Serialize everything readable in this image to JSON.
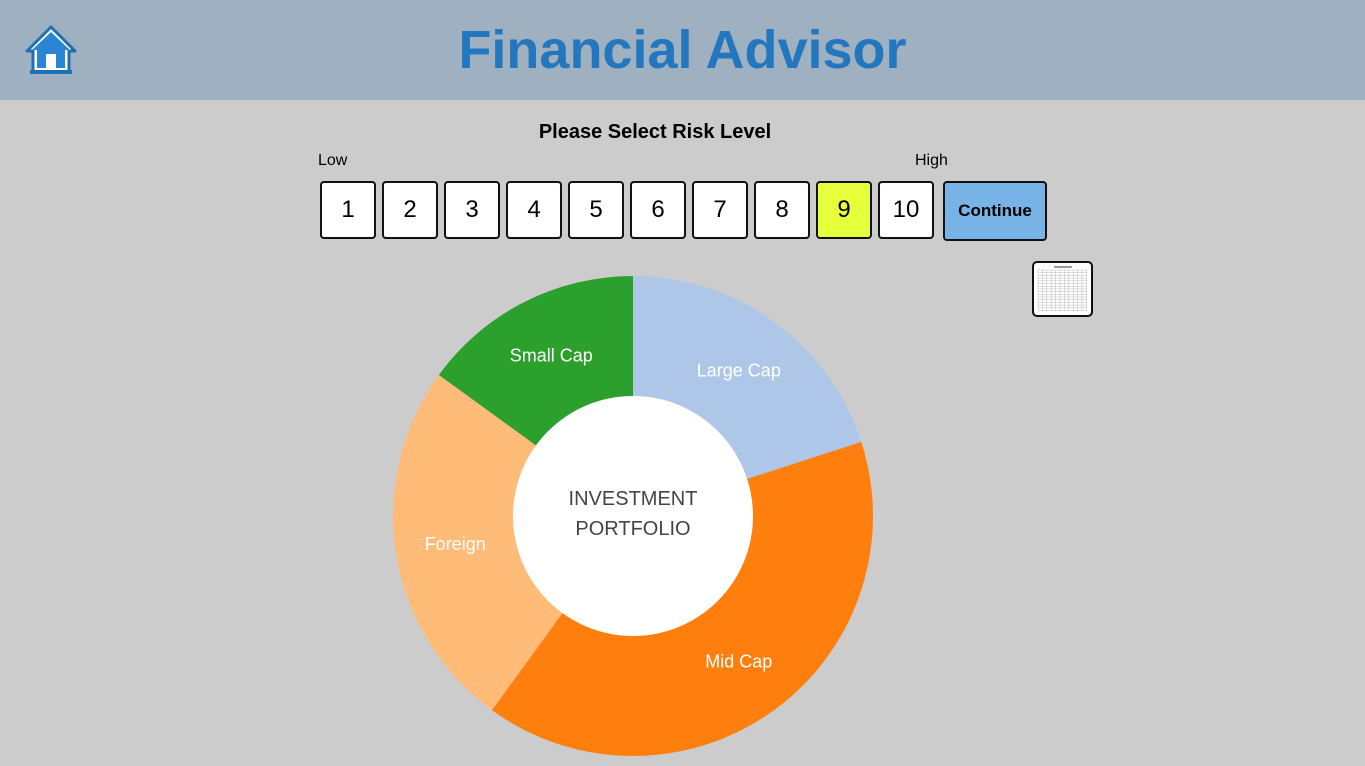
{
  "header": {
    "title": "Financial Advisor",
    "home_icon": "home-icon",
    "background": "#9fb0c1",
    "title_color": "#2377bf"
  },
  "risk": {
    "heading": "Please Select Risk Level",
    "low_label": "Low",
    "high_label": "High",
    "levels": [
      "1",
      "2",
      "3",
      "4",
      "5",
      "6",
      "7",
      "8",
      "9",
      "10"
    ],
    "selected": "9",
    "selected_color": "#e6ff3b",
    "continue_label": "Continue",
    "continue_color": "#77b3e6"
  },
  "table_icon": "spreadsheet-thumbnail-icon",
  "chart_data": {
    "type": "pie",
    "donut": true,
    "center_label": [
      "INVESTMENT",
      "PORTFOLIO"
    ],
    "start_angle_deg": 0,
    "slices": [
      {
        "name": "Large Cap",
        "value": 20,
        "color": "#aec7e8"
      },
      {
        "name": "Mid Cap",
        "value": 40,
        "color": "#ff7f0e"
      },
      {
        "name": "Foreign",
        "value": 25,
        "color": "#ffbb78"
      },
      {
        "name": "Small Cap",
        "value": 15,
        "color": "#2ca02c"
      }
    ]
  }
}
